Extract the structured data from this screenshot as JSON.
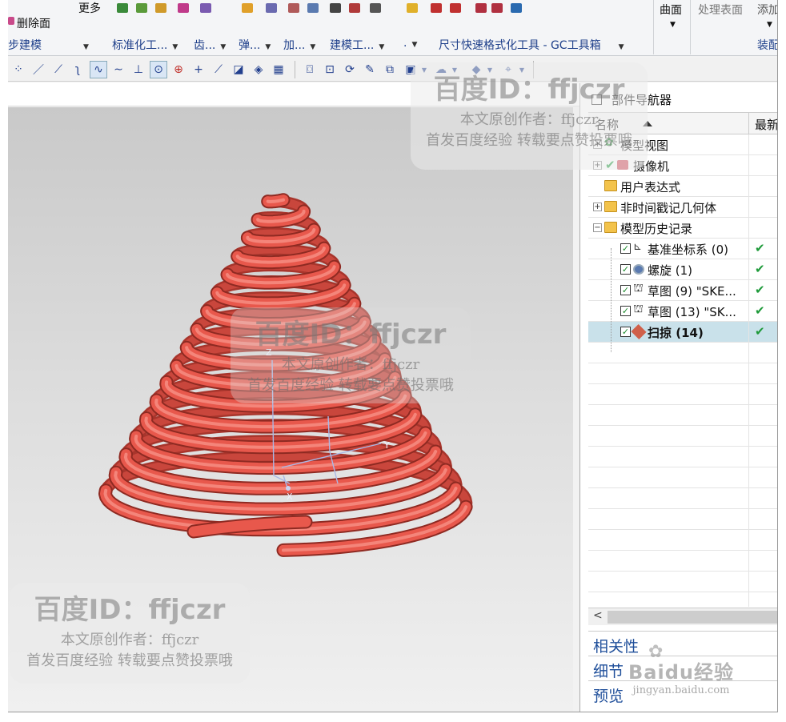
{
  "ribbon": {
    "delete_face": "删除面",
    "more": "更多",
    "surface": "曲面",
    "process_face": "处理表面",
    "add": "添加",
    "groups": [
      "步建模",
      "标准化工...",
      "齿...",
      "弹...",
      "加...",
      "建模工...",
      ".",
      "尺寸快速格式化工具 - GC工具箱",
      "装配"
    ]
  },
  "navigator": {
    "title": "部件导航器",
    "col_name": "名称",
    "col_latest": "最新",
    "rows": [
      {
        "label": "模型视图"
      },
      {
        "label": "摄像机"
      },
      {
        "label": "用户表达式"
      },
      {
        "label": "非时间戳记几何体"
      },
      {
        "label": "模型历史记录"
      },
      {
        "label": "基准坐标系 (0)"
      },
      {
        "label": "螺旋 (1)"
      },
      {
        "label": "草图 (9) \"SKE..."
      },
      {
        "label": "草图 (13) \"SK..."
      },
      {
        "label": "扫掠 (14)"
      }
    ],
    "panels": [
      "相关性",
      "细节",
      "预览"
    ]
  },
  "viewport": {
    "axis_z": "Z",
    "axis_x": "X",
    "axis_y": "Y"
  },
  "watermark": {
    "title": "百度ID：ffjczr",
    "line1": "本文原创作者：ffjczr",
    "line2": "首发百度经验 转载要点赞投票哦",
    "brand": "Baidu经验",
    "url": "jingyan.baidu.com"
  },
  "colors": {
    "spring": "#e8584c",
    "selected_row": "#c9e1ea",
    "link_blue": "#1e4e9a",
    "check_green": "#1e9a3a"
  }
}
